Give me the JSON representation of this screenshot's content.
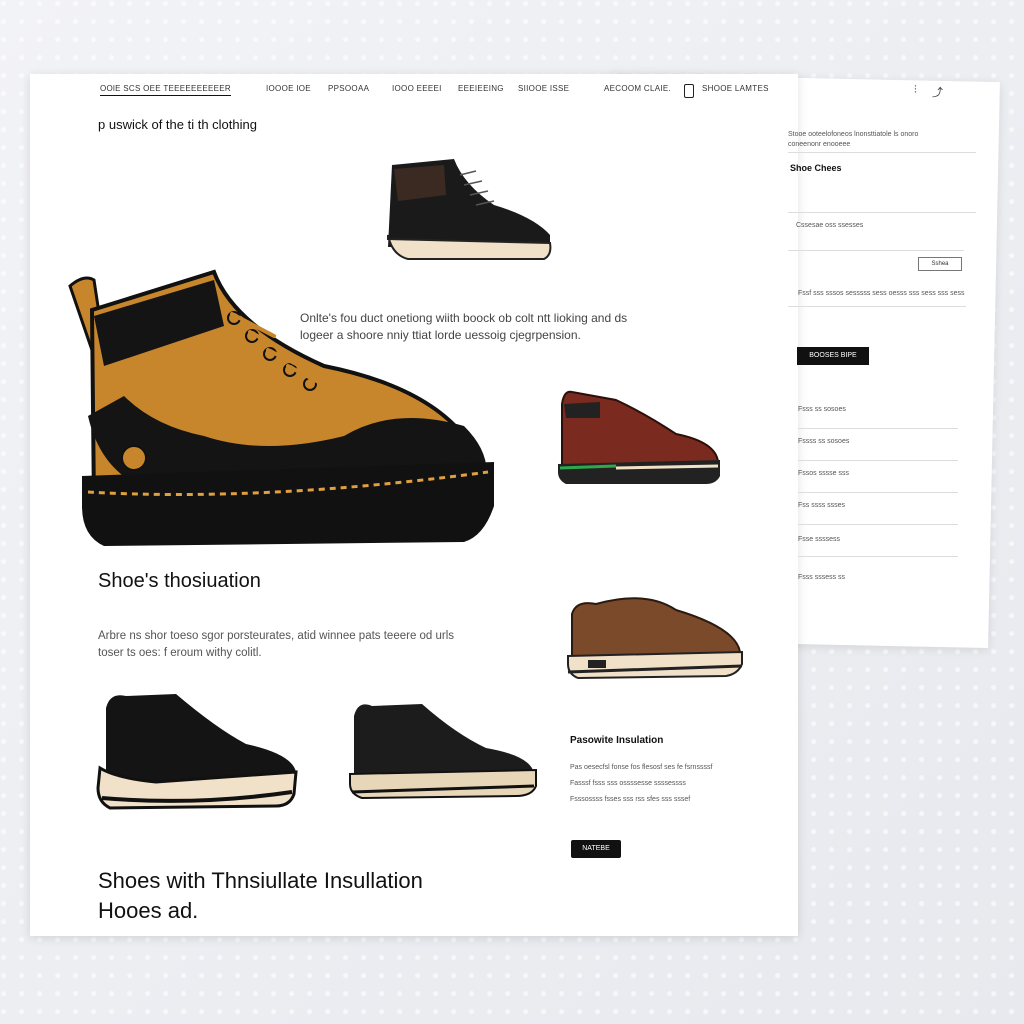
{
  "nav": {
    "brand": "OOlE SCS OEE TEEEEEEEEEER",
    "links": [
      "IOOOE IOE",
      "PPSOOAA",
      "IOOO EEEEI",
      "EEEIEEING",
      "SIIOOE ISSE"
    ],
    "account": "AECOOM CLAIE.",
    "cart": "SHOOE LAMTES"
  },
  "tagline": "p uswick of the ti th clothing",
  "hero": {
    "text": "Onlte's fou duct onetiong wiith boock ob colt ntt lioking and ds logeer a shoore nniy ttiat lorde uessoig cjegrpension."
  },
  "section": {
    "title": "Shoe's thosiuation",
    "desc": "Arbre ns shor toeso sgor porsteurates, atid winnee pats teeere od urls toser ts oes: f eroum withy colitl."
  },
  "bottom": {
    "title_line1": "Shoes with Thnsiullate Insullation",
    "title_line2": "Hooes ad."
  },
  "feature": {
    "title": "Pasowite Insulation",
    "lines": [
      "Pas oesecfsl fonse fos flesosf ses fe fsrnssssf",
      "Fasssf fsss sss ossssesse ssssessss",
      "Fsssossss fsses sss rss sfes sss sssef"
    ],
    "button": "NATEBE"
  },
  "side": {
    "header": "Stooe ooteelofoneos lnonsttiatole ls onoro coneenonr enooeee",
    "title": "Shoe Chees",
    "line1": "Cssesae oss ssesses",
    "input": "Sshea",
    "line2": "Fssf sss sssos sesssss sess oesss sss sess sss sess",
    "button": "BOOSES BIPE",
    "items": [
      "Fsss ss sosoes",
      "Fssss ss sosoes",
      "Fssos sssse sss",
      "Fss ssss ssses",
      "Fsse ssssess",
      "Fsss sssess ss"
    ]
  },
  "colors": {
    "boot_tan": "#c8862c",
    "boot_black": "#111111",
    "sole_cream": "#f1e1c8",
    "maroon": "#7a2a1f",
    "brown": "#7a4a2a",
    "accent_green": "#2fa84a"
  }
}
